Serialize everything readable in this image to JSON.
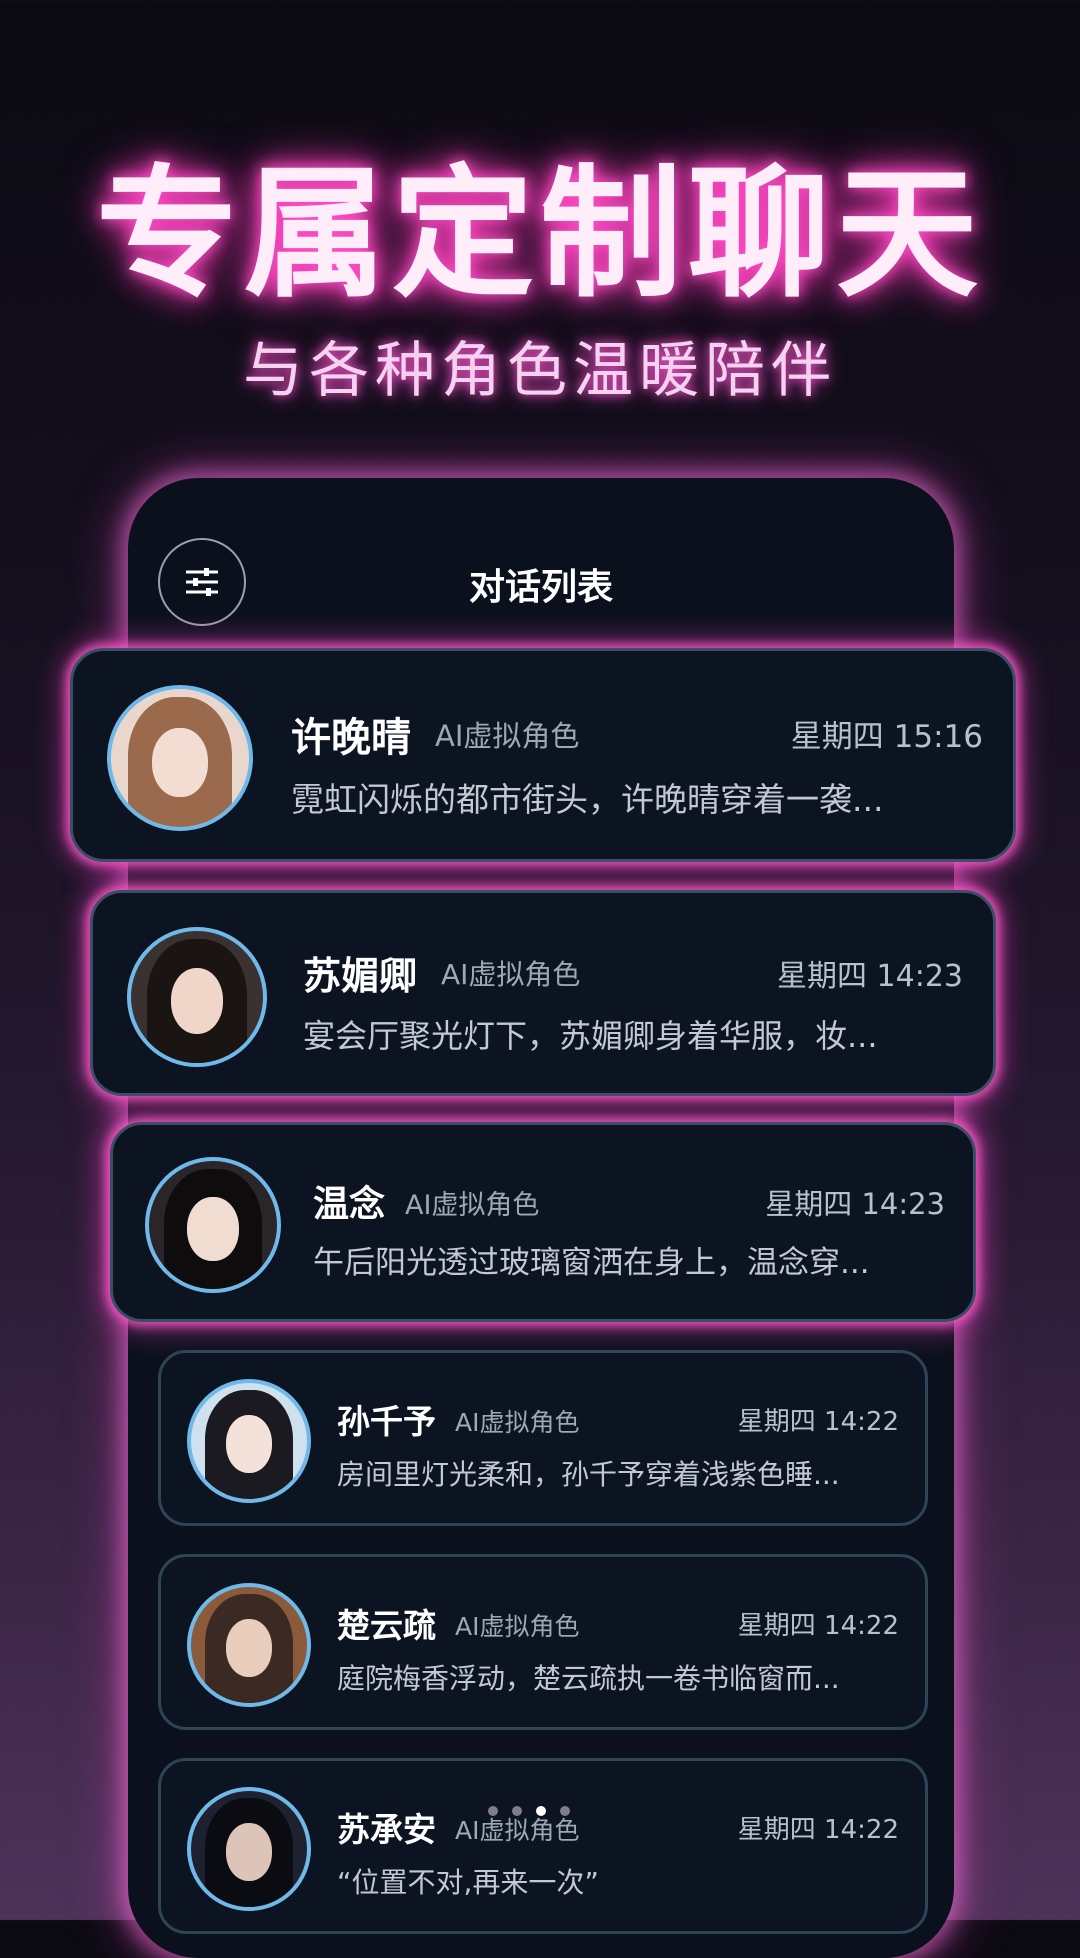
{
  "headline": "专属定制聊天",
  "subline": "与各种角色温暖陪伴",
  "screen": {
    "title": "对话列表"
  },
  "chats": [
    {
      "name": "许晚晴",
      "tag": "AI虚拟角色",
      "time": "星期四 15:16",
      "preview": "霓虹闪烁的都市街头，许晚晴穿着一袭..."
    },
    {
      "name": "苏媚卿",
      "tag": "AI虚拟角色",
      "time": "星期四 14:23",
      "preview": "宴会厅聚光灯下，苏媚卿身着华服，妆..."
    },
    {
      "name": "温念",
      "tag": "AI虚拟角色",
      "time": "星期四 14:23",
      "preview": "午后阳光透过玻璃窗洒在身上，温念穿..."
    },
    {
      "name": "孙千予",
      "tag": "AI虚拟角色",
      "time": "星期四 14:22",
      "preview": "房间里灯光柔和，孙千予穿着浅紫色睡..."
    },
    {
      "name": "楚云疏",
      "tag": "AI虚拟角色",
      "time": "星期四 14:22",
      "preview": "庭院梅香浮动，楚云疏执一卷书临窗而..."
    },
    {
      "name": "苏承安",
      "tag": "AI虚拟角色",
      "time": "星期四 14:22",
      "preview": "“位置不对,再来一次”"
    }
  ],
  "pager": {
    "count": 4,
    "active": 3
  },
  "colors": {
    "neon": "#ff4fc8",
    "avatar_ring": "#6fb9ea",
    "card_bg": "#0c1422"
  }
}
